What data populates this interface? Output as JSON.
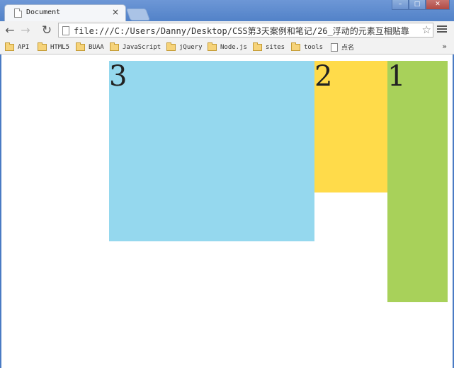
{
  "tab": {
    "title": "Document",
    "close_glyph": "×"
  },
  "window_buttons": [
    "–",
    "□",
    "✕"
  ],
  "address_bar": {
    "url": "file:///C:/Users/Danny/Desktop/CSS第3天案例和笔记/26_浮动的元素互相贴靠"
  },
  "nav": {
    "back": "←",
    "forward": "→",
    "reload": "↻",
    "star": "☆"
  },
  "bookmarks": {
    "items": [
      {
        "label": "API",
        "icon": "folder-icon"
      },
      {
        "label": "HTML5",
        "icon": "folder-icon"
      },
      {
        "label": "BUAA",
        "icon": "folder-icon"
      },
      {
        "label": "JavaScript",
        "icon": "folder-icon"
      },
      {
        "label": "jQuery",
        "icon": "folder-icon"
      },
      {
        "label": "Node.js",
        "icon": "folder-icon"
      },
      {
        "label": "sites",
        "icon": "folder-icon"
      },
      {
        "label": "tools",
        "icon": "folder-icon"
      },
      {
        "label": "点名",
        "icon": "page-icon"
      }
    ],
    "more": "»"
  },
  "boxes": [
    {
      "label": "3",
      "color": "#95d8ee"
    },
    {
      "label": "2",
      "color": "#ffdb4a"
    },
    {
      "label": "1",
      "color": "#a8d15a"
    }
  ]
}
